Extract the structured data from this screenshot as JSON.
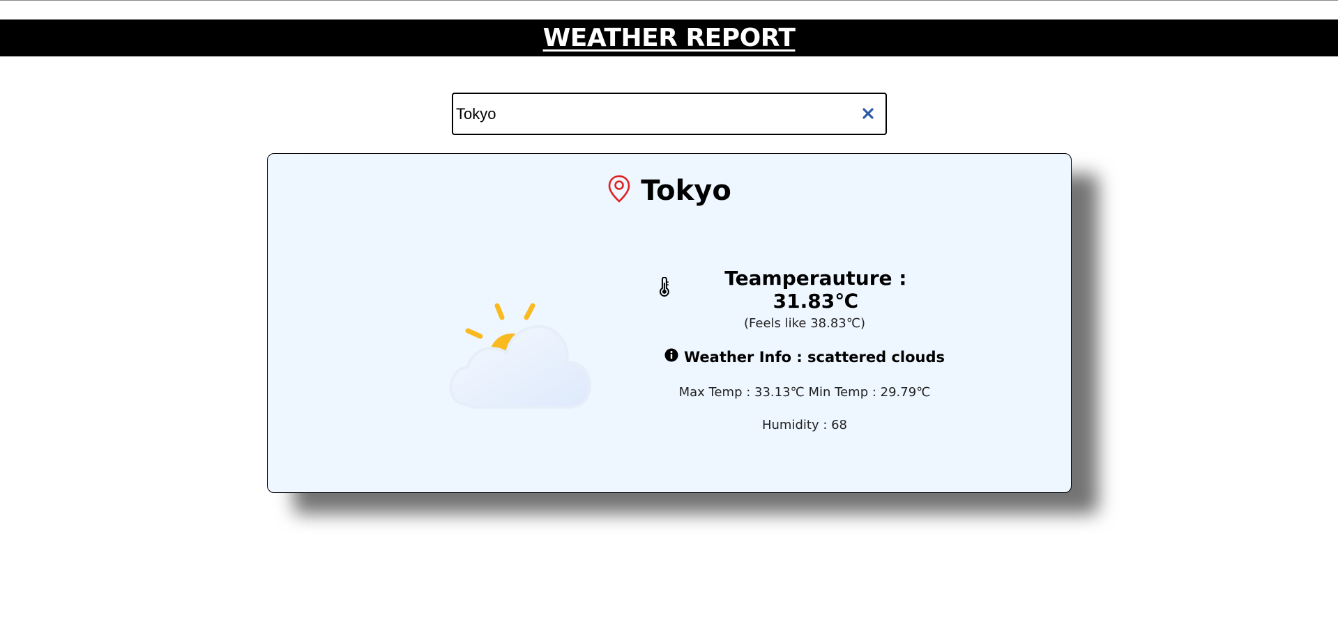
{
  "header": {
    "title": "WEATHER REPORT"
  },
  "search": {
    "value": "Tokyo",
    "clear_icon": "close-icon"
  },
  "card": {
    "city": "Tokyo",
    "location_icon": "map-pin-icon",
    "weather_icon": "partly-cloudy-icon",
    "temperature_label": "Teamperauture : 31.83℃",
    "feels_like": "(Feels like 38.83℃)",
    "weather_info": "Weather Info : scattered clouds",
    "max_min": "Max Temp : 33.13℃ Min Temp : 29.79℃",
    "humidity": "Humidity : 68"
  },
  "colors": {
    "header_bg": "#000000",
    "card_bg": "#eef6ff",
    "pin": "#e02020",
    "sun": "#f9b91f",
    "clear_icon": "#2b5aa8"
  }
}
